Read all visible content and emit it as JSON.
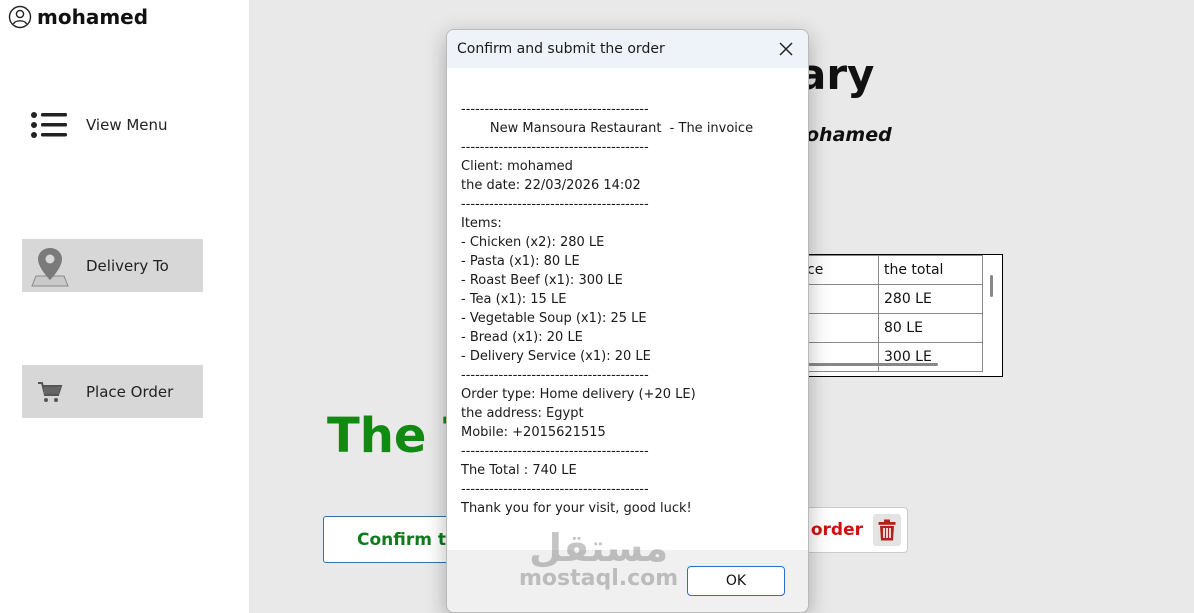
{
  "sidebar": {
    "user_name": "mohamed",
    "items": [
      {
        "label": "View Menu",
        "icon": "menu-icon"
      },
      {
        "label": "Delivery To",
        "icon": "location-icon"
      },
      {
        "label": "Place Order",
        "icon": "cart-icon"
      }
    ]
  },
  "main": {
    "title_fragment": "ary",
    "subtitle_fragment": "ohamed",
    "table": {
      "headers": [
        "ce",
        "the total"
      ],
      "rows": [
        [
          "",
          "280 LE"
        ],
        [
          "",
          "80 LE"
        ],
        [
          "",
          "300 LE"
        ]
      ]
    },
    "total_fragment": "The T",
    "confirm_button": "Confirm th",
    "delete_button": "e order"
  },
  "dialog": {
    "title": "Confirm and submit the order",
    "lines": [
      "----------------------------------------",
      "       New Mansoura Restaurant  - The invoice",
      "----------------------------------------",
      "Client: mohamed",
      "the date: 22/03/2026 14:02",
      "----------------------------------------",
      "Items:",
      "- Chicken (x2): 280 LE",
      "- Pasta (x1): 80 LE",
      "- Roast Beef (x1): 300 LE",
      "- Tea (x1): 15 LE",
      "- Vegetable Soup (x1): 25 LE",
      "- Bread (x1): 20 LE",
      "- Delivery Service (x1): 20 LE",
      "----------------------------------------",
      "Order type: Home delivery (+20 LE)",
      "the address: Egypt",
      "Mobile: +2015621515",
      "----------------------------------------",
      "The Total : 740 LE",
      "----------------------------------------",
      "Thank you for your visit, good luck!"
    ],
    "ok_label": "OK"
  },
  "watermark": {
    "arabic": "مستقل",
    "latin": "mostaql.com"
  },
  "colors": {
    "total_green": "#118a11",
    "delete_red": "#d01010",
    "confirm_green": "#0f7a1e",
    "ok_border": "#2a6ecb"
  }
}
